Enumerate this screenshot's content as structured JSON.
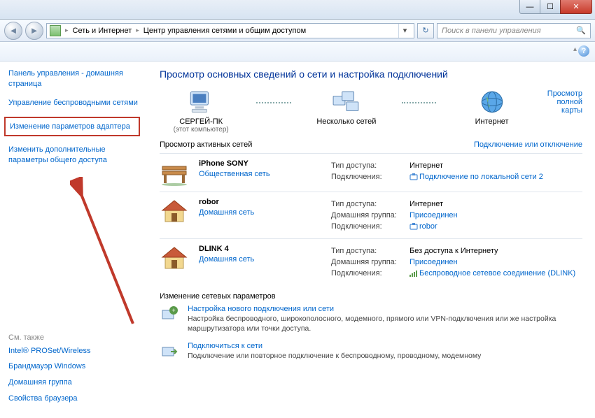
{
  "titlebar": {
    "min": "—",
    "max": "☐",
    "close": "✕"
  },
  "nav": {
    "breadcrumb1": "Сеть и Интернет",
    "breadcrumb2": "Центр управления сетями и общим доступом",
    "search_placeholder": "Поиск в панели управления"
  },
  "sidebar": {
    "items": [
      "Панель управления - домашняя страница",
      "Управление беспроводными сетями",
      "Изменение параметров адаптера",
      "Изменить дополнительные параметры общего доступа"
    ],
    "see_also": "См. также",
    "bottom": [
      "Intel® PROSet/Wireless",
      "Брандмауэр Windows",
      "Домашняя группа",
      "Свойства браузера"
    ]
  },
  "main": {
    "title": "Просмотр основных сведений о сети и настройка подключений",
    "map_link": "Просмотр полной карты",
    "node1": "СЕРГЕЙ-ПК",
    "node1_sub": "(этот компьютер)",
    "node2": "Несколько сетей",
    "node3": "Интернет",
    "active_hdr": "Просмотр активных сетей",
    "active_right": "Подключение или отключение",
    "labels": {
      "access": "Тип доступа:",
      "homegroup": "Домашняя группа:",
      "connections": "Подключения:"
    },
    "networks": [
      {
        "name": "iPhone SONY",
        "type": "Общественная сеть",
        "icon": "bench",
        "access": "Интернет",
        "homegroup": "",
        "conn_icon": "eth",
        "conn": "Подключение по локальной сети 2"
      },
      {
        "name": "robor",
        "type": "Домашняя сеть",
        "icon": "house",
        "access": "Интернет",
        "homegroup": "Присоединен",
        "conn_icon": "eth",
        "conn": "robor"
      },
      {
        "name": "DLINK  4",
        "type": "Домашняя сеть",
        "icon": "house",
        "access": "Без доступа к Интернету",
        "homegroup": "Присоединен",
        "conn_icon": "wifi",
        "conn": "Беспроводное сетевое соединение (DLINK)"
      }
    ],
    "tasks_hdr": "Изменение сетевых параметров",
    "tasks": [
      {
        "title": "Настройка нового подключения или сети",
        "desc": "Настройка беспроводного, широкополосного, модемного, прямого или VPN-подключения или же настройка маршрутизатора или точки доступа."
      },
      {
        "title": "Подключиться к сети",
        "desc": "Подключение или повторное подключение к беспроводному, проводному, модемному"
      }
    ]
  }
}
